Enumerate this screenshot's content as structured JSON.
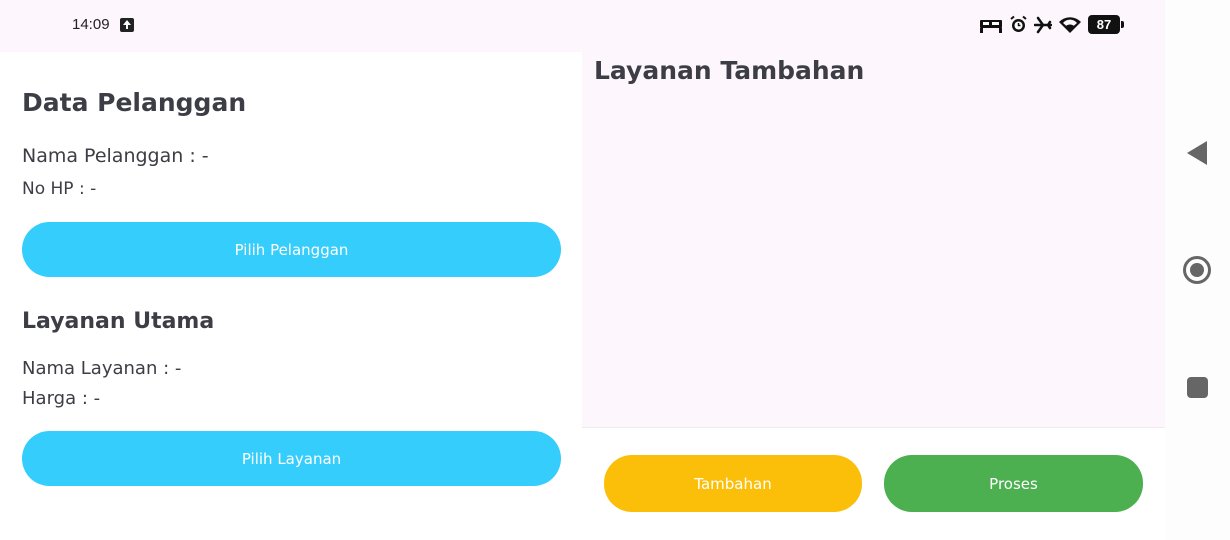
{
  "statusbar": {
    "time": "14:09",
    "battery": "87",
    "icons": [
      "upload-icon",
      "bed-icon",
      "alarm-icon",
      "airplane-icon",
      "wifi-icon",
      "battery-icon"
    ]
  },
  "customer": {
    "title": "Data Pelanggan",
    "name_line": "Nama Pelanggan : -",
    "phone_line": "No HP : -",
    "select_button": "Pilih Pelanggan"
  },
  "main_service": {
    "title": "Layanan Utama",
    "name_line": "Nama Layanan : -",
    "price_line": "Harga : -",
    "select_button": "Pilih Layanan"
  },
  "additional": {
    "title": "Layanan Tambahan"
  },
  "actions": {
    "add_button": "Tambahan",
    "process_button": "Proses"
  },
  "colors": {
    "primary_blue": "#35cdfc",
    "add_yellow": "#fbbf0a",
    "process_green": "#4caf50",
    "background": "#fdf7fd"
  },
  "navbar": {
    "icons": [
      "back-icon",
      "home-icon",
      "recents-icon"
    ]
  }
}
